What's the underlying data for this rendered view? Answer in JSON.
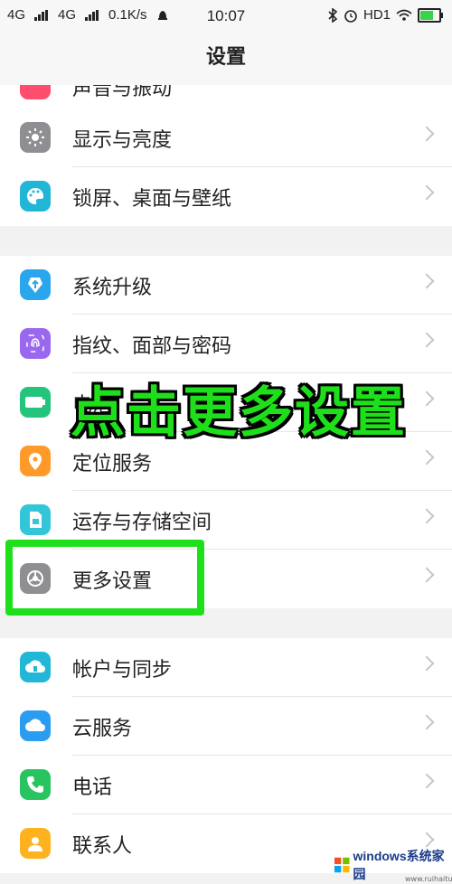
{
  "status_bar": {
    "sim1": "4G",
    "sim2": "4G",
    "speed": "0.1K/s",
    "time": "10:07",
    "hd": "HD1"
  },
  "header": {
    "title": "设置"
  },
  "settings": {
    "partial_item": "声音与振动",
    "group1": [
      {
        "label": "显示与亮度",
        "icon": "sun-icon",
        "color": "#8e8e93"
      },
      {
        "label": "锁屏、桌面与壁纸",
        "icon": "palette-icon",
        "color": "#22b6d6"
      }
    ],
    "group2": [
      {
        "label": "系统升级",
        "icon": "upgrade-icon",
        "color": "#2aa6ef"
      },
      {
        "label": "指纹、面部与密码",
        "icon": "fingerprint-icon",
        "color": "#9a67ef"
      },
      {
        "label": "电池",
        "icon": "battery-icon",
        "color": "#25c47d"
      },
      {
        "label": "定位服务",
        "icon": "location-icon",
        "color": "#ff9a2a"
      },
      {
        "label": "运存与存储空间",
        "icon": "storage-icon",
        "color": "#33c6d9"
      },
      {
        "label": "更多设置",
        "icon": "gear-icon",
        "color": "#8e8e93"
      }
    ],
    "group3": [
      {
        "label": "帐户与同步",
        "icon": "cloud-sync-icon",
        "color": "#22b7d6"
      },
      {
        "label": "云服务",
        "icon": "cloud-icon",
        "color": "#2b9df1"
      },
      {
        "label": "电话",
        "icon": "phone-icon",
        "color": "#28c45f"
      },
      {
        "label": "联系人",
        "icon": "contact-icon",
        "color": "#ffb21f"
      }
    ]
  },
  "overlay": {
    "caption": "点击更多设置"
  },
  "watermark": {
    "brand": "windows系统家园",
    "url": "www.ruihaitu.com"
  }
}
